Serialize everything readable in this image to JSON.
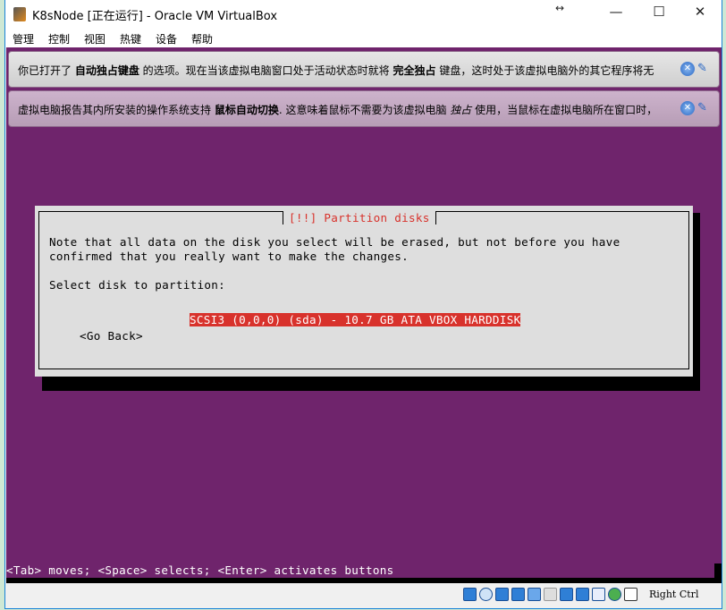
{
  "window": {
    "title": "K8sNode [正在运行] - Oracle VM VirtualBox",
    "controls": {
      "resize": "↔",
      "minimize": "—",
      "maximize": "☐",
      "close": "✕"
    }
  },
  "menu": [
    "管理",
    "控制",
    "视图",
    "热键",
    "设备",
    "帮助"
  ],
  "notifications": [
    {
      "pre": "你已打开了 ",
      "b1": "自动独占键盘",
      "mid": " 的选项。现在当该虚拟电脑窗口处于活动状态时就将 ",
      "b2": "完全独占",
      "post": " 键盘，这时处于该虚拟电脑外的其它程序将无"
    },
    {
      "pre": "虚拟电脑报告其内所安装的操作系统支持 ",
      "b1": "鼠标自动切换",
      "mid": ". 这意味着鼠标不需要为该虚拟电脑 ",
      "i": "独占",
      "post": " 使用，当鼠标在虚拟电脑所在窗口时，"
    }
  ],
  "installer": {
    "title": "[!!] Partition disks",
    "line1": "Note that all data on the disk you select will be erased, but not before you have",
    "line2": "confirmed that you really want to make the changes.",
    "prompt": "Select disk to partition:",
    "disk": "SCSI3 (0,0,0) (sda) - 10.7 GB ATA VBOX HARDDISK",
    "back": "<Go Back>",
    "hint": "<Tab> moves; <Space> selects; <Enter> activates buttons"
  },
  "status": {
    "host_key": "Right Ctrl",
    "icons": [
      "hard-disk",
      "optical-drive",
      "audio",
      "network",
      "usb",
      "shared-folders",
      "display",
      "capture",
      "cpu",
      "mouse-integration",
      "keyboard-capture"
    ]
  },
  "colors": {
    "vm_bg": "#6f246c",
    "dialog_bg": "#dedede",
    "accent": "#d8322c"
  }
}
